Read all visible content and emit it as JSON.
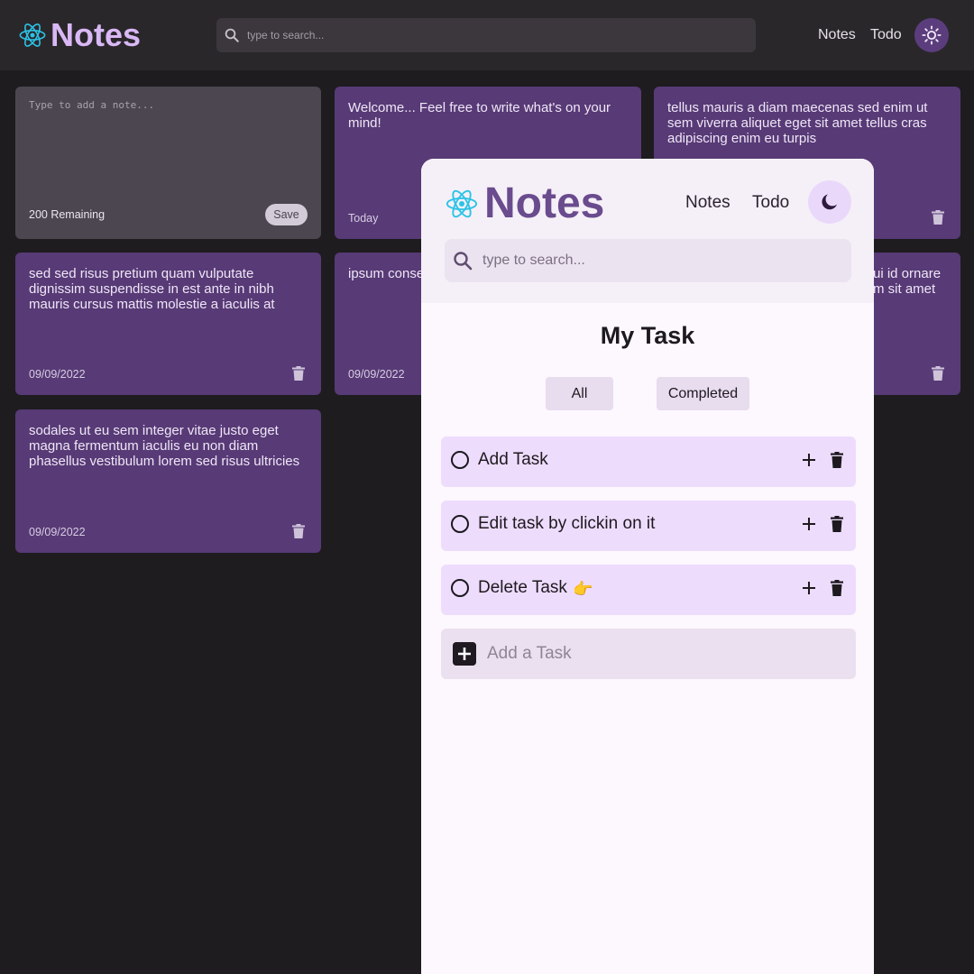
{
  "app": {
    "logo_text": "Notes",
    "colors": {
      "dark_bg": "#1e1c1f",
      "card": "#573a76",
      "accent": "#6a4b8e",
      "task_bg": "#eedcfd"
    }
  },
  "dark_header": {
    "search_placeholder": "type to search...",
    "nav": [
      "Notes",
      "Todo"
    ],
    "theme_icon": "sun-icon"
  },
  "new_note": {
    "placeholder": "Type to add a note...",
    "remaining": "200 Remaining",
    "save_label": "Save"
  },
  "notes": [
    {
      "text": "Welcome... Feel free to write what's on your mind!",
      "date": "Today"
    },
    {
      "text": "tellus mauris a diam maecenas sed enim ut sem viverra aliquet eget sit amet tellus cras adipiscing enim eu turpis",
      "date": ""
    },
    {
      "text": "sed sed risus pretium quam vulputate dignissim suspendisse in est ante in nibh mauris cursus mattis molestie a iaculis at",
      "date": "09/09/2022"
    },
    {
      "text": "ipsum conse id leo in vitae tempus eges",
      "date": "09/09/2022"
    },
    {
      "text": "ui id ornare m sit amet",
      "date": ""
    },
    {
      "text": "sodales ut eu sem integer vitae justo eget magna fermentum iaculis eu non diam phasellus vestibulum lorem sed risus ultricies",
      "date": "09/09/2022"
    }
  ],
  "light_header": {
    "logo_text": "Notes",
    "nav": [
      "Notes",
      "Todo"
    ],
    "theme_icon": "moon-icon",
    "search_placeholder": "type to search..."
  },
  "todo": {
    "title": "My Task",
    "filters": [
      "All",
      "Completed"
    ],
    "tasks": [
      {
        "label": "Add Task"
      },
      {
        "label": "Edit task by clickin on it"
      },
      {
        "label": "Delete Task",
        "emoji": "👉"
      }
    ],
    "add_placeholder": "Add a Task"
  }
}
